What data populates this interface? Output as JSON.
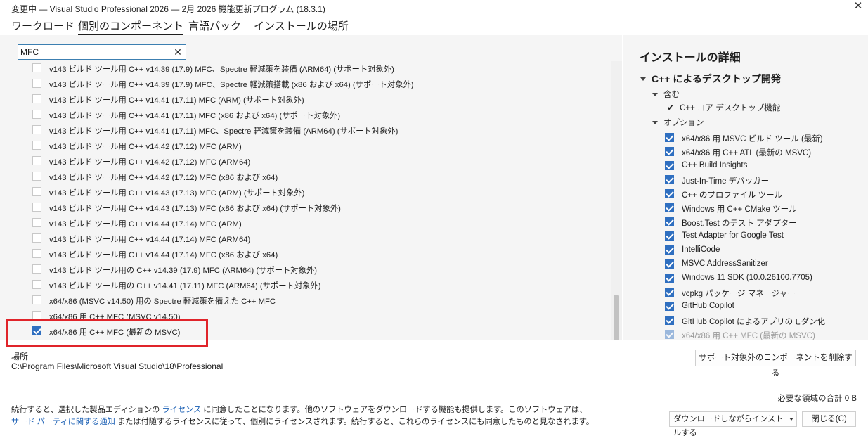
{
  "window": {
    "title": "変更中 — Visual Studio Professional 2026 — 2月 2026 機能更新プログラム (18.3.1)",
    "close_glyph": "✕"
  },
  "tabs": [
    {
      "label": "ワークロード",
      "active": false
    },
    {
      "label": "個別のコンポーネント",
      "active": true
    },
    {
      "label": "言語パック",
      "active": false
    },
    {
      "label": "インストールの場所",
      "active": false
    }
  ],
  "search": {
    "value": "MFC",
    "placeholder": "",
    "clear_glyph": "✕"
  },
  "components": [
    {
      "label": "v143 ビルド ツール用 C++ v14.39 (17.9) MFC、Spectre 軽減策を装備 (ARM64) (サポート対象外)",
      "checked": false
    },
    {
      "label": "v143 ビルド ツール用 C++ v14.39 (17.9) MFC、Spectre 軽減策搭載 (x86 および x64) (サポート対象外)",
      "checked": false
    },
    {
      "label": "v143 ビルド ツール用 C++ v14.41 (17.11) MFC (ARM) (サポート対象外)",
      "checked": false
    },
    {
      "label": "v143 ビルド ツール用 C++ v14.41 (17.11) MFC (x86 および x64) (サポート対象外)",
      "checked": false
    },
    {
      "label": "v143 ビルド ツール用 C++ v14.41 (17.11) MFC、Spectre 軽減策を装備 (ARM64) (サポート対象外)",
      "checked": false
    },
    {
      "label": "v143 ビルド ツール用 C++ v14.42 (17.12) MFC (ARM)",
      "checked": false
    },
    {
      "label": "v143 ビルド ツール用 C++ v14.42 (17.12) MFC (ARM64)",
      "checked": false
    },
    {
      "label": "v143 ビルド ツール用 C++ v14.42 (17.12) MFC (x86 および x64)",
      "checked": false
    },
    {
      "label": "v143 ビルド ツール用 C++ v14.43 (17.13) MFC (ARM) (サポート対象外)",
      "checked": false
    },
    {
      "label": "v143 ビルド ツール用 C++ v14.43 (17.13) MFC (x86 および x64) (サポート対象外)",
      "checked": false
    },
    {
      "label": "v143 ビルド ツール用 C++ v14.44 (17.14) MFC (ARM)",
      "checked": false
    },
    {
      "label": "v143 ビルド ツール用 C++ v14.44 (17.14) MFC (ARM64)",
      "checked": false
    },
    {
      "label": "v143 ビルド ツール用 C++ v14.44 (17.14) MFC (x86 および x64)",
      "checked": false
    },
    {
      "label": "v143 ビルド ツール用の C++ v14.39 (17.9) MFC (ARM64) (サポート対象外)",
      "checked": false
    },
    {
      "label": "v143 ビルド ツール用の C++ v14.41 (17.11) MFC (ARM64) (サポート対象外)",
      "checked": false
    },
    {
      "label": "x64/x86 (MSVC v14.50) 用の Spectre 軽減策を備えた C++ MFC",
      "checked": false
    },
    {
      "label": "x64/x86 用 C++ MFC (MSVC v14.50)",
      "checked": false
    },
    {
      "label": "x64/x86 用 C++ MFC (最新の MSVC)",
      "checked": true
    }
  ],
  "details": {
    "title": "インストールの詳細",
    "workload": "C++ によるデスクトップ開発",
    "included_label": "含む",
    "included_items": [
      {
        "label": "C++ コア デスクトップ機能",
        "check_glyph": "✔"
      }
    ],
    "optional_label": "オプション",
    "optional_items": [
      {
        "label": "x64/x86 用 MSVC ビルド ツール (最新)",
        "checked": true
      },
      {
        "label": "x64/x86 用 C++ ATL (最新の MSVC)",
        "checked": true
      },
      {
        "label": "C++ Build Insights",
        "checked": true
      },
      {
        "label": "Just-In-Time デバッガー",
        "checked": true
      },
      {
        "label": "C++ のプロファイル ツール",
        "checked": true
      },
      {
        "label": "Windows 用 C++ CMake ツール",
        "checked": true
      },
      {
        "label": "Boost.Test のテスト アダプター",
        "checked": true
      },
      {
        "label": "Test Adapter for Google Test",
        "checked": true
      },
      {
        "label": "IntelliCode",
        "checked": true
      },
      {
        "label": "MSVC AddressSanitizer",
        "checked": true
      },
      {
        "label": "Windows 11 SDK (10.0.26100.7705)",
        "checked": true
      },
      {
        "label": "vcpkg パッケージ マネージャー",
        "checked": true
      },
      {
        "label": "GitHub Copilot",
        "checked": true
      },
      {
        "label": "GitHub Copilot によるアプリのモダン化",
        "checked": true
      },
      {
        "label": "x64/x86 用 C++ MFC (最新の MSVC)",
        "checked": true
      }
    ]
  },
  "location": {
    "label": "場所",
    "path": "C:\\Program Files\\Microsoft Visual Studio\\18\\Professional"
  },
  "buttons": {
    "remove_unsupported": "サポート対象外のコンポーネントを削除する",
    "install_mode": "ダウンロードしながらインストールする",
    "close": "閉じる(C)"
  },
  "total_size": "必要な領域の合計  0 B",
  "license": {
    "part1": "続行すると、選択した製品エディションの ",
    "link1": "ライセンス",
    "part2": " に同意したことになります。他のソフトウェアをダウンロードする機能も提供します。このソフトウェアは、",
    "link2": "サード パーティに関する通知",
    "part3": " または付随するライセンスに従って、個別にライセンスされます。続行すると、これらのライセンスにも同意したものと見なされます。"
  },
  "colors": {
    "accent": "#2f6fc0",
    "highlight": "#e0242a",
    "link": "#1a5fb4"
  }
}
